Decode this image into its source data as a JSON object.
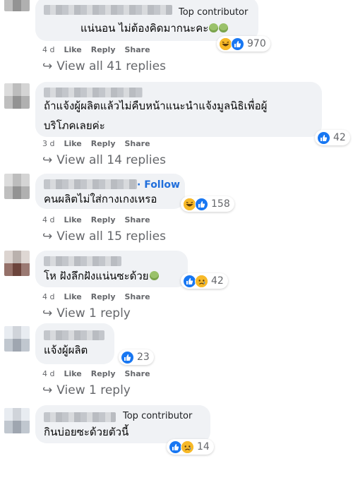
{
  "comments": [
    {
      "badge": "Top contributor",
      "text_lines": [
        "แน่นอน ไม่ต้องคิดมากนะคะ"
      ],
      "time": "4 d",
      "like": "Like",
      "reply": "Reply",
      "share": "Share",
      "replies": "View all 41 replies",
      "reaction_count": "970"
    },
    {
      "text_lines": [
        "ถ้าแจ้งผู้ผลิตแล้วไม่คืบหน้าแนะนำแจ้งมูลนิธิเพื่อผู้",
        "บริโภคเลยค่ะ"
      ],
      "time": "3 d",
      "like": "Like",
      "reply": "Reply",
      "share": "Share",
      "replies": "View all 14 replies",
      "reaction_count": "42"
    },
    {
      "follow": "· Follow",
      "text_lines": [
        "คนผลิตไม่ใส่กางเกงเหรอ"
      ],
      "time": "4 d",
      "like": "Like",
      "reply": "Reply",
      "share": "Share",
      "replies": "View all 15 replies",
      "reaction_count": "158"
    },
    {
      "text_lines": [
        "โห ฝังลึกฝังแน่นซะด้วย"
      ],
      "time": "4 d",
      "like": "Like",
      "reply": "Reply",
      "share": "Share",
      "replies": "View 1 reply",
      "reaction_count": "42"
    },
    {
      "text_lines": [
        "แจ้งผู้ผลิต"
      ],
      "time": "4 d",
      "like": "Like",
      "reply": "Reply",
      "share": "Share",
      "replies": "View 1 reply",
      "reaction_count": "23"
    },
    {
      "badge": "Top contributor",
      "text_lines": [
        "กินบ่อยซะด้วยตัวนี้"
      ],
      "reaction_count": "14"
    }
  ],
  "icons": {
    "reply_arrow": "↪",
    "like": "like-icon",
    "haha": "haha-icon",
    "sad": "sad-icon"
  },
  "colors": {
    "bubble": "#f0f2f5",
    "like_blue": "#1877f2",
    "follow_blue": "#216fdb",
    "meta_gray": "#65676b"
  }
}
